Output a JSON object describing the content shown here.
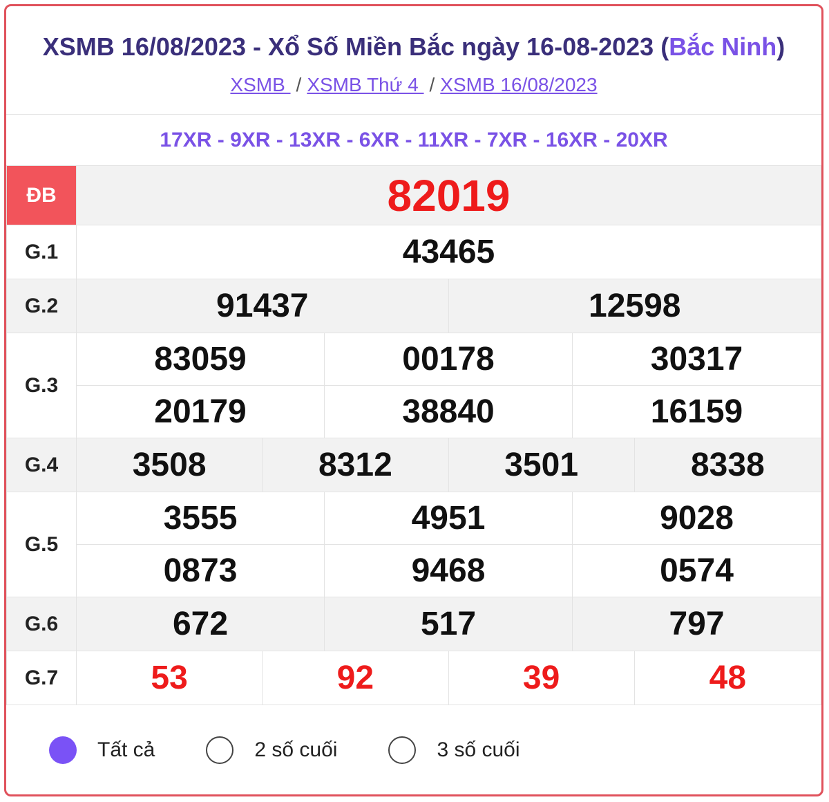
{
  "header": {
    "title_main": "XSMB 16/08/2023 - Xổ Số Miền Bắc ngày 16-08-2023 (",
    "title_province": "Bắc Ninh",
    "title_close": ")"
  },
  "breadcrumb": [
    {
      "label": "XSMB "
    },
    {
      "label": "XSMB Thứ 4 "
    },
    {
      "label": "XSMB 16/08/2023"
    }
  ],
  "breadcrumb_sep": "/",
  "codes": "17XR - 9XR - 13XR - 6XR - 11XR - 7XR - 16XR - 20XR",
  "prizes": {
    "db": {
      "label": "ĐB",
      "numbers": [
        "82019"
      ]
    },
    "g1": {
      "label": "G.1",
      "numbers": [
        "43465"
      ]
    },
    "g2": {
      "label": "G.2",
      "numbers": [
        "91437",
        "12598"
      ]
    },
    "g3": {
      "label": "G.3",
      "numbers": [
        "83059",
        "00178",
        "30317",
        "20179",
        "38840",
        "16159"
      ]
    },
    "g4": {
      "label": "G.4",
      "numbers": [
        "3508",
        "8312",
        "3501",
        "8338"
      ]
    },
    "g5": {
      "label": "G.5",
      "numbers": [
        "3555",
        "4951",
        "9028",
        "0873",
        "9468",
        "0574"
      ]
    },
    "g6": {
      "label": "G.6",
      "numbers": [
        "672",
        "517",
        "797"
      ]
    },
    "g7": {
      "label": "G.7",
      "numbers": [
        "53",
        "92",
        "39",
        "48"
      ]
    }
  },
  "filters": [
    {
      "label": "Tất cả",
      "selected": true
    },
    {
      "label": "2 số cuối",
      "selected": false
    },
    {
      "label": "3 số cuối",
      "selected": false
    }
  ],
  "colors": {
    "accent": "#7a52e6",
    "prize_red": "#ee1b1b",
    "db_label_bg": "#f2545b",
    "border": "#e0525c"
  }
}
